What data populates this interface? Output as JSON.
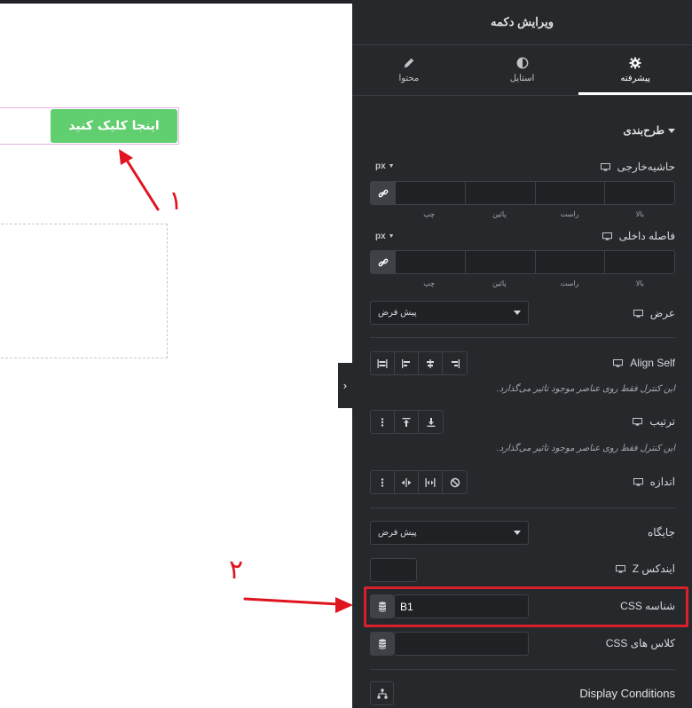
{
  "canvas": {
    "button_text": "اینجا کلیک کنید",
    "annotation_1": "۱",
    "annotation_2": "۲"
  },
  "panel": {
    "title": "ویرایش دکمه",
    "tabs": [
      {
        "label": "محتوا",
        "icon": "pencil-icon"
      },
      {
        "label": "استایل",
        "icon": "half-circle-icon"
      },
      {
        "label": "پیشرفته",
        "icon": "gear-icon",
        "active": true
      }
    ],
    "section": "طرح‌بندی",
    "margin": {
      "label": "حاشیه‌خارجی",
      "unit": "px",
      "sides": [
        "بالا",
        "راست",
        "پائین",
        "چپ"
      ]
    },
    "padding": {
      "label": "فاصله داخلی",
      "unit": "px",
      "sides": [
        "بالا",
        "راست",
        "پائین",
        "چپ"
      ]
    },
    "width": {
      "label": "عرض",
      "value": "پیش فرض"
    },
    "align_self": {
      "label": "Align Self",
      "note": "این کنترل فقط روی عناصر موجود تاثیر می‌گذارد."
    },
    "order": {
      "label": "ترتیب",
      "note": "این کنترل فقط روی عناصر موجود تاثیر می‌گذارد."
    },
    "size": {
      "label": "اندازه"
    },
    "position": {
      "label": "جایگاه",
      "value": "پیش فرض"
    },
    "z_index": {
      "label": "ایندکس Z",
      "value": ""
    },
    "css_id": {
      "label": "شناسه CSS",
      "value": "B1"
    },
    "css_classes": {
      "label": "کلاس های CSS",
      "value": ""
    },
    "display_conditions": "Display Conditions"
  },
  "colors": {
    "accent": "#61ce70",
    "panel_bg": "#26292c",
    "annotation": "#d9202a"
  }
}
